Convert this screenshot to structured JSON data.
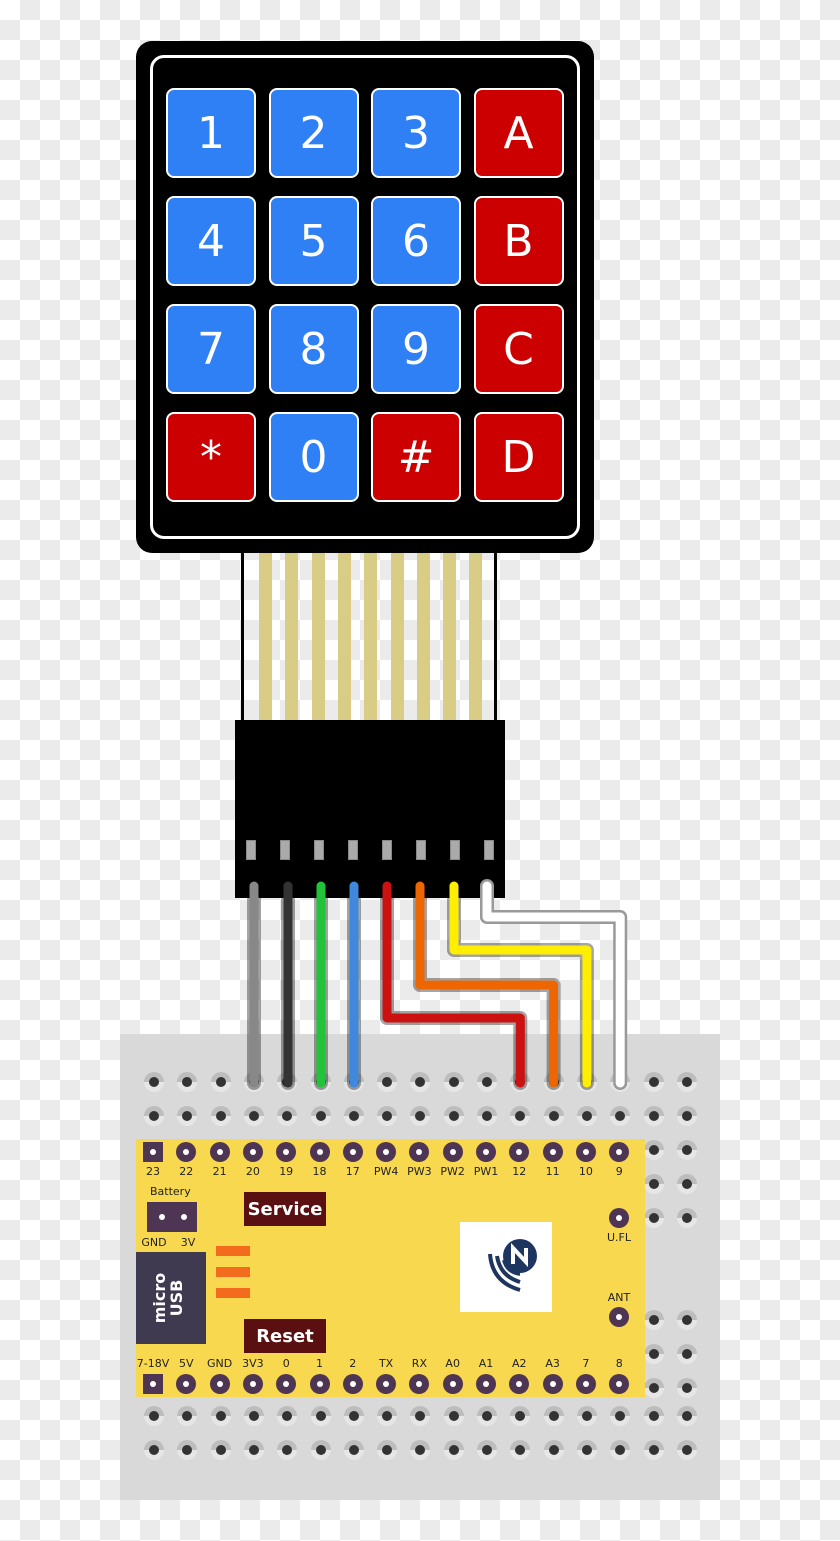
{
  "keypad": {
    "keys": [
      {
        "label": "1",
        "color": "blue"
      },
      {
        "label": "2",
        "color": "blue"
      },
      {
        "label": "3",
        "color": "blue"
      },
      {
        "label": "A",
        "color": "red"
      },
      {
        "label": "4",
        "color": "blue"
      },
      {
        "label": "5",
        "color": "blue"
      },
      {
        "label": "6",
        "color": "blue"
      },
      {
        "label": "B",
        "color": "red"
      },
      {
        "label": "7",
        "color": "blue"
      },
      {
        "label": "8",
        "color": "blue"
      },
      {
        "label": "9",
        "color": "blue"
      },
      {
        "label": "C",
        "color": "red"
      },
      {
        "label": "*",
        "color": "red"
      },
      {
        "label": "0",
        "color": "blue"
      },
      {
        "label": "#",
        "color": "red"
      },
      {
        "label": "D",
        "color": "red"
      }
    ],
    "colors": {
      "blue": "#2f80f4",
      "red": "#cc0000"
    }
  },
  "ribbon": {
    "strip_count": 9
  },
  "connector": {
    "pin_count": 8
  },
  "wires": [
    {
      "color": "gray",
      "hex": "#888888",
      "to_pin": "20"
    },
    {
      "color": "black",
      "hex": "#333333",
      "to_pin": "19"
    },
    {
      "color": "green",
      "hex": "#22c23a",
      "to_pin": "18"
    },
    {
      "color": "blue",
      "hex": "#3f88db",
      "to_pin": "17"
    },
    {
      "color": "red",
      "hex": "#cc1111",
      "to_pin": "12"
    },
    {
      "color": "orange",
      "hex": "#ee6600",
      "to_pin": "11"
    },
    {
      "color": "yellow",
      "hex": "#ffee00",
      "to_pin": "10"
    },
    {
      "color": "white",
      "hex": "#ffffff",
      "to_pin": "9"
    }
  ],
  "board": {
    "top_pins": [
      "23",
      "22",
      "21",
      "20",
      "19",
      "18",
      "17",
      "PW4",
      "PW3",
      "PW2",
      "PW1",
      "12",
      "11",
      "10",
      "9"
    ],
    "bottom_pins": [
      "7-18V",
      "5V",
      "GND",
      "3V3",
      "0",
      "1",
      "2",
      "TX",
      "RX",
      "A0",
      "A1",
      "A2",
      "A3",
      "7",
      "8"
    ],
    "battery": {
      "label": "Battery",
      "gnd": "GND",
      "v3": "3V"
    },
    "usb": {
      "line1": "micro",
      "line2": "USB"
    },
    "service_button": "Service",
    "reset_button": "Reset",
    "ufl_label": "U.FL",
    "ant_label": "ANT",
    "colors": {
      "board": "#f8d84f",
      "pad": "#4e3553",
      "button": "#5a1010",
      "led": "#f36b1c",
      "logo": "#1e3560"
    }
  }
}
